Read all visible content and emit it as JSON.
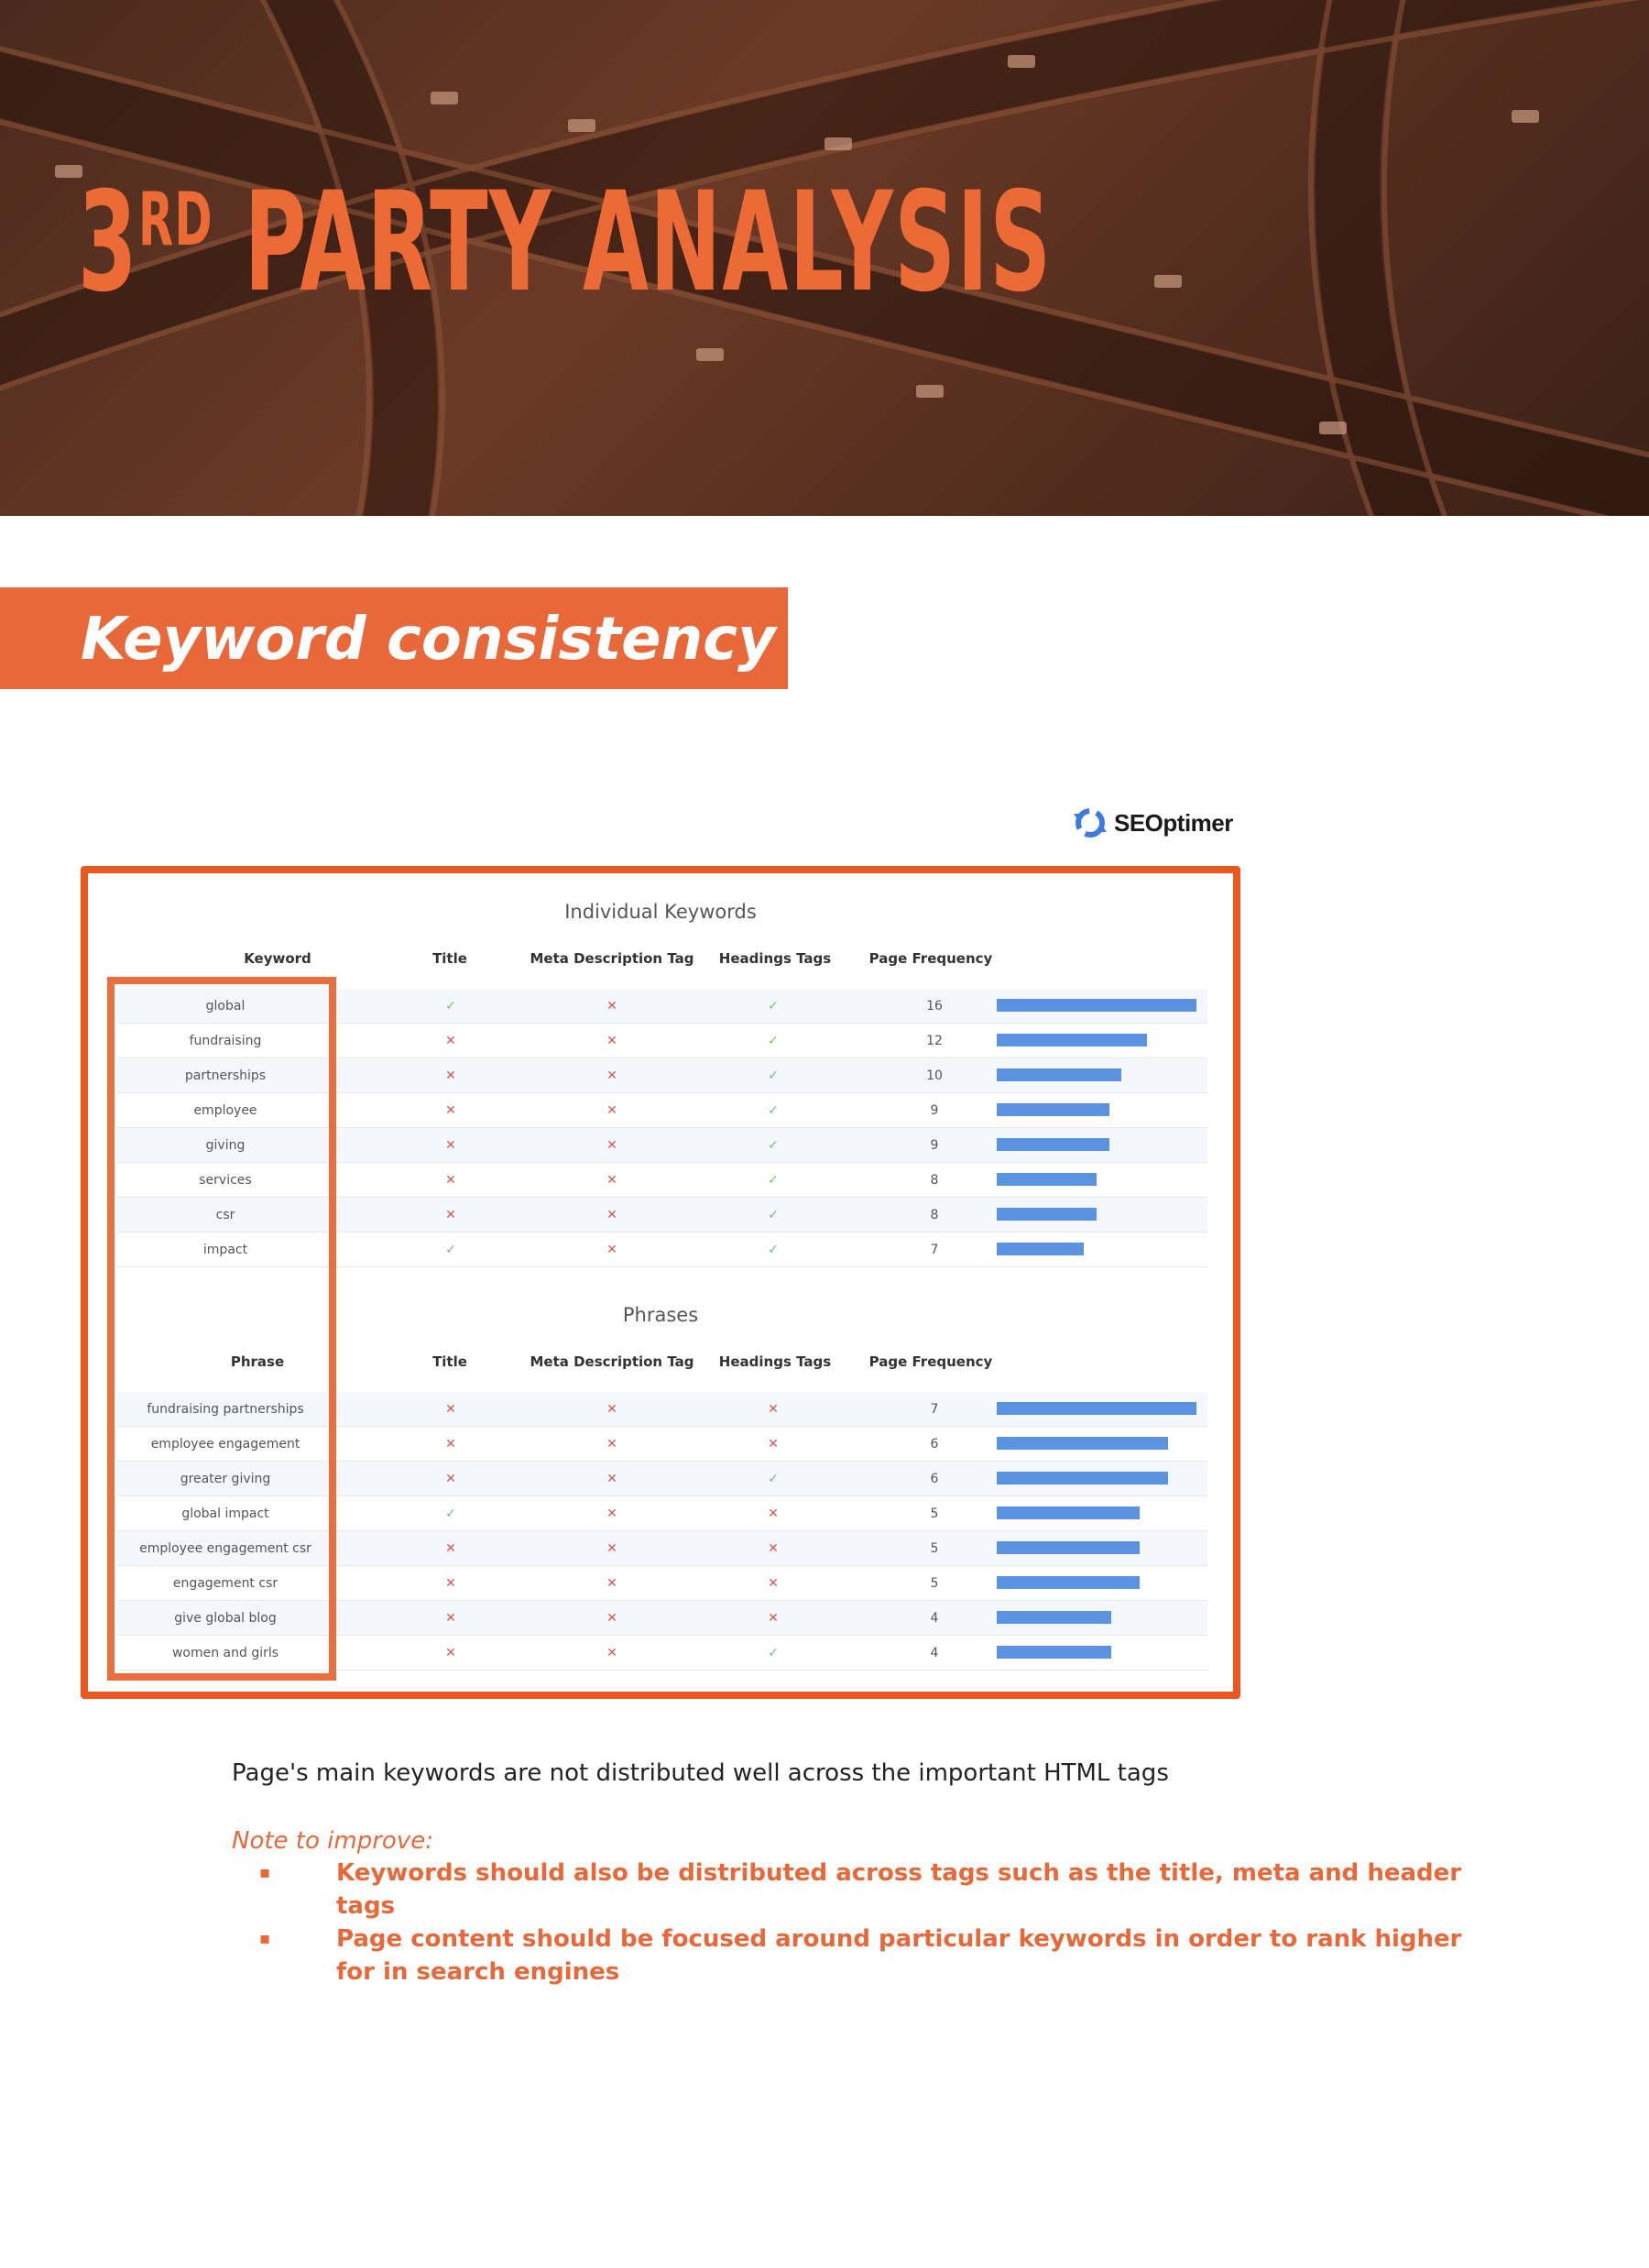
{
  "hero": {
    "title_main": "3",
    "title_sup": "RD",
    "title_rest": " PARTY ANALYSIS"
  },
  "section": {
    "label": "Keyword consistency"
  },
  "logo": {
    "text": "SEOptimer",
    "icon": "gear-sync-icon"
  },
  "colors": {
    "accent": "#e8683a",
    "frame": "#e8581f",
    "bar": "#5b93e0",
    "check": "#6cc36c",
    "cross": "#e0554d"
  },
  "keywords": {
    "title": "Individual Keywords",
    "headers": [
      "Keyword",
      "Title",
      "Meta Description Tag",
      "Headings Tags",
      "Page Frequency"
    ],
    "rows": [
      {
        "label": "global",
        "title": "✓",
        "meta": "✕",
        "headings": "✓",
        "freq": "16",
        "value": 16
      },
      {
        "label": "fundraising",
        "title": "✕",
        "meta": "✕",
        "headings": "✓",
        "freq": "12",
        "value": 12
      },
      {
        "label": "partnerships",
        "title": "✕",
        "meta": "✕",
        "headings": "✓",
        "freq": "10",
        "value": 10
      },
      {
        "label": "employee",
        "title": "✕",
        "meta": "✕",
        "headings": "✓",
        "freq": "9",
        "value": 9
      },
      {
        "label": "giving",
        "title": "✕",
        "meta": "✕",
        "headings": "✓",
        "freq": "9",
        "value": 9
      },
      {
        "label": "services",
        "title": "✕",
        "meta": "✕",
        "headings": "✓",
        "freq": "8",
        "value": 8
      },
      {
        "label": "csr",
        "title": "✕",
        "meta": "✕",
        "headings": "✓",
        "freq": "8",
        "value": 8
      },
      {
        "label": "impact",
        "title": "✓",
        "meta": "✕",
        "headings": "✓",
        "freq": "7",
        "value": 7
      }
    ]
  },
  "phrases": {
    "title": "Phrases",
    "headers": [
      "Phrase",
      "Title",
      "Meta Description Tag",
      "Headings Tags",
      "Page Frequency"
    ],
    "rows": [
      {
        "label": "fundraising partnerships",
        "title": "✕",
        "meta": "✕",
        "headings": "✕",
        "freq": "7",
        "value": 7
      },
      {
        "label": "employee engagement",
        "title": "✕",
        "meta": "✕",
        "headings": "✕",
        "freq": "6",
        "value": 6
      },
      {
        "label": "greater giving",
        "title": "✕",
        "meta": "✕",
        "headings": "✓",
        "freq": "6",
        "value": 6
      },
      {
        "label": "global impact",
        "title": "✓",
        "meta": "✕",
        "headings": "✕",
        "freq": "5",
        "value": 5
      },
      {
        "label": "employee engagement csr",
        "title": "✕",
        "meta": "✕",
        "headings": "✕",
        "freq": "5",
        "value": 5
      },
      {
        "label": "engagement csr",
        "title": "✕",
        "meta": "✕",
        "headings": "✕",
        "freq": "5",
        "value": 5
      },
      {
        "label": "give global blog",
        "title": "✕",
        "meta": "✕",
        "headings": "✕",
        "freq": "4",
        "value": 4
      },
      {
        "label": "women and girls",
        "title": "✕",
        "meta": "✕",
        "headings": "✓",
        "freq": "4",
        "value": 4
      }
    ]
  },
  "summary": "Page's main keywords are not distributed well across the important HTML tags",
  "note": {
    "label": "Note to improve:",
    "bullets": [
      {
        "marker": "▪",
        "text": "Keywords should also be distributed across tags such as the title, meta and header tags"
      },
      {
        "marker": "▪",
        "text": "Page content should be focused around particular keywords in order to rank higher for in search engines"
      }
    ]
  }
}
